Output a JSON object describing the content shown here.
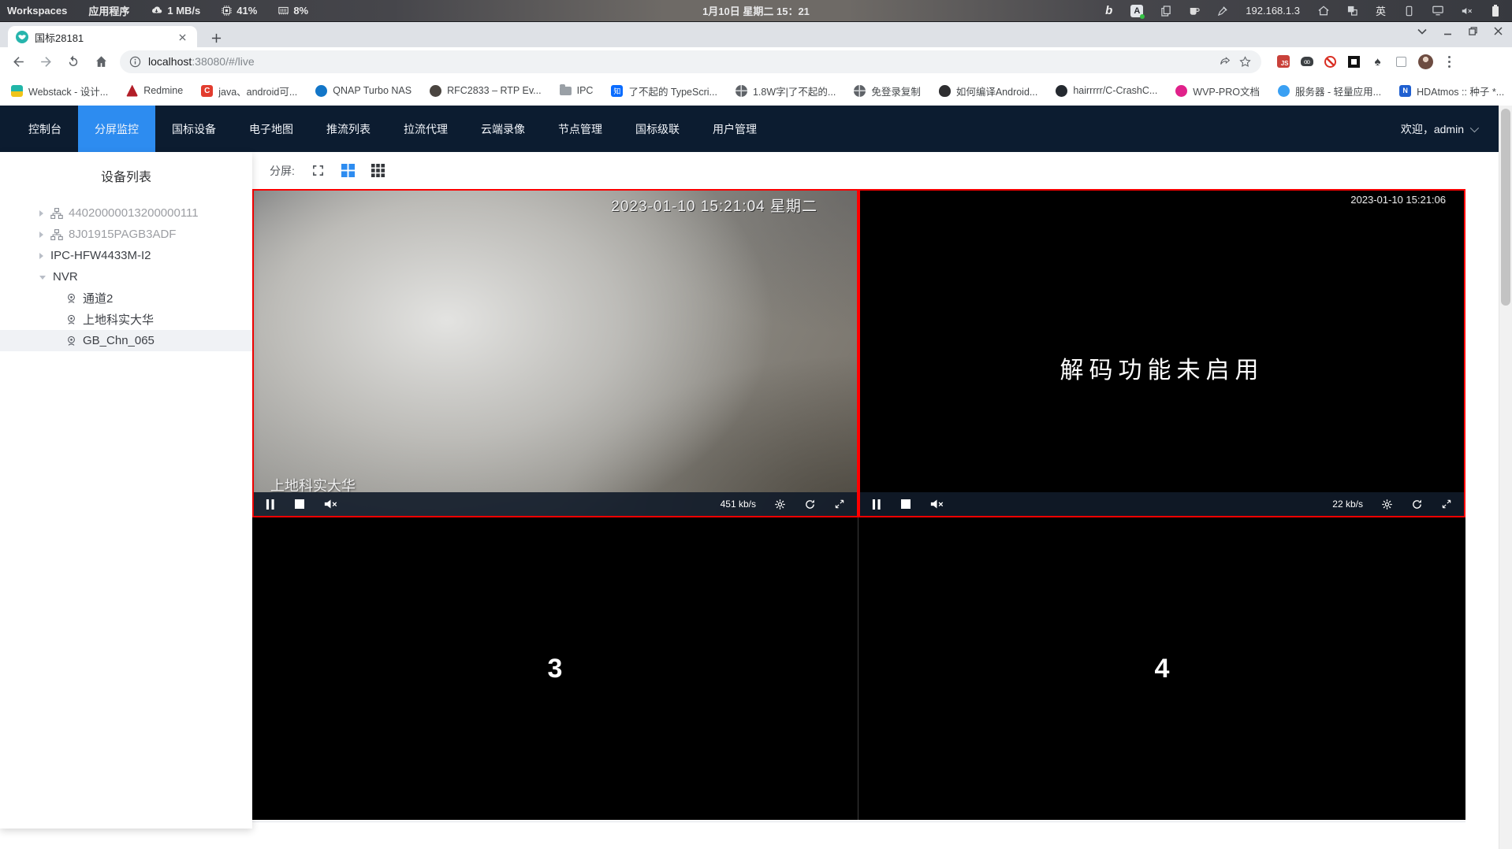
{
  "taskbar": {
    "workspaces_label": "Workspaces",
    "applications_label": "应用程序",
    "net_speed": "1 MB/s",
    "cpu_usage": "41%",
    "mem_usage": "8%",
    "clock": "1月10日 星期二 15：21",
    "bing_glyph": "b",
    "input_badge": "A",
    "ip_address": "192.168.1.3",
    "input_method": "英"
  },
  "browser": {
    "tab_title": "国标28181",
    "url": {
      "host": "localhost",
      "rest": ":38080/#/live"
    },
    "extensions": {
      "js_badge": "JS"
    },
    "bookmarks": [
      {
        "label": "Webstack - 设计...",
        "glyph": ""
      },
      {
        "label": "Redmine",
        "glyph": ""
      },
      {
        "label": "java、android可...",
        "glyph": "C"
      },
      {
        "label": "QNAP Turbo NAS",
        "glyph": ""
      },
      {
        "label": "RFC2833 – RTP Ev...",
        "glyph": ""
      },
      {
        "label": "IPC",
        "glyph": ""
      },
      {
        "label": "了不起的 TypeScri...",
        "glyph": "知"
      },
      {
        "label": "1.8W字|了不起的...",
        "glyph": ""
      },
      {
        "label": "免登录复制",
        "glyph": ""
      },
      {
        "label": "如何编译Android...",
        "glyph": ""
      },
      {
        "label": "hairrrrr/C-CrashC...",
        "glyph": ""
      },
      {
        "label": "WVP-PRO文档",
        "glyph": ""
      },
      {
        "label": "服务器 - 轻量应用...",
        "glyph": ""
      },
      {
        "label": "HDAtmos :: 种子 *...",
        "glyph": "N"
      }
    ],
    "bookmarks_overflow": "»"
  },
  "nav": {
    "items": [
      {
        "label": "控制台"
      },
      {
        "label": "分屏监控"
      },
      {
        "label": "国标设备"
      },
      {
        "label": "电子地图"
      },
      {
        "label": "推流列表"
      },
      {
        "label": "拉流代理"
      },
      {
        "label": "云端录像"
      },
      {
        "label": "节点管理"
      },
      {
        "label": "国标级联"
      },
      {
        "label": "用户管理"
      }
    ],
    "welcome": "欢迎，admin"
  },
  "sidebar": {
    "title": "设备列表",
    "tree": [
      {
        "label": "44020000013200000111"
      },
      {
        "label": "8J01915PAGB3ADF"
      },
      {
        "label": "IPC-HFW4433M-I2"
      },
      {
        "label": "NVR"
      },
      {
        "label": "通道2"
      },
      {
        "label": "上地科实大华"
      },
      {
        "label": "GB_Chn_065"
      }
    ]
  },
  "screen_toolbar": {
    "split_label": "分屏:"
  },
  "players": {
    "video1": {
      "timestamp": "2023-01-10 15:21:04 星期二",
      "watermark": "上地科实大华",
      "bitrate": "451 kb/s"
    },
    "video2": {
      "timestamp": "2023-01-10 15:21:06",
      "message": "解码功能未启用",
      "bitrate": "22 kb/s"
    },
    "video3": {
      "placeholder": "3"
    },
    "video4": {
      "placeholder": "4"
    }
  },
  "colors": {
    "accent": "#2d8cf0",
    "nav_bg": "#0c1c30",
    "playing_border": "#fe0000",
    "selected_row_bg": "#f0f2f5"
  }
}
